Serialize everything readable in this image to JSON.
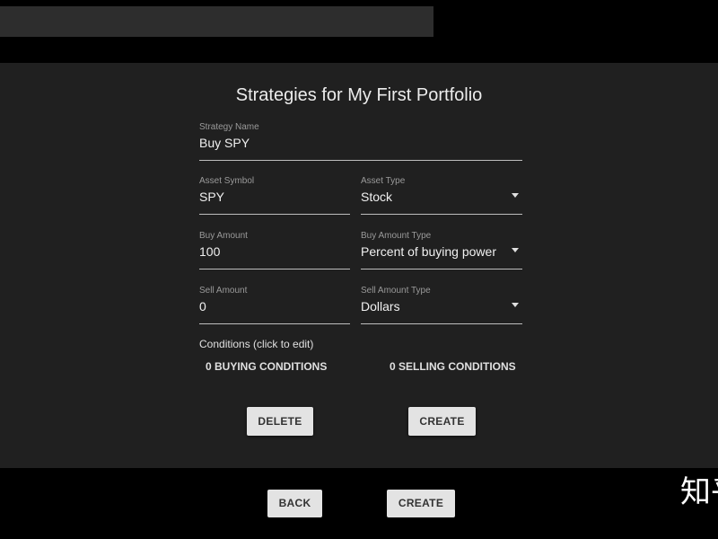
{
  "form": {
    "title": "Strategies for My First Portfolio",
    "strategy_name": {
      "label": "Strategy Name",
      "value": "Buy SPY"
    },
    "asset_symbol": {
      "label": "Asset Symbol",
      "value": "SPY"
    },
    "asset_type": {
      "label": "Asset Type",
      "value": "Stock"
    },
    "buy_amount": {
      "label": "Buy Amount",
      "value": "100"
    },
    "buy_amount_type": {
      "label": "Buy Amount Type",
      "value": "Percent of buying power"
    },
    "sell_amount": {
      "label": "Sell Amount",
      "value": "0"
    },
    "sell_amount_type": {
      "label": "Sell Amount Type",
      "value": "Dollars"
    },
    "conditions_label": "Conditions (click to edit)",
    "buying_conditions": "0 BUYING CONDITIONS",
    "selling_conditions": "0 SELLING CONDITIONS",
    "delete_label": "DELETE",
    "create_label": "CREATE"
  },
  "footer": {
    "back_label": "BACK",
    "create_label": "CREATE"
  },
  "watermark": "知乎",
  "icons": {
    "dropdown": "caret-down-icon"
  },
  "colors": {
    "background": "#000000",
    "panel": "#202020",
    "button": "#e3e3e3"
  }
}
